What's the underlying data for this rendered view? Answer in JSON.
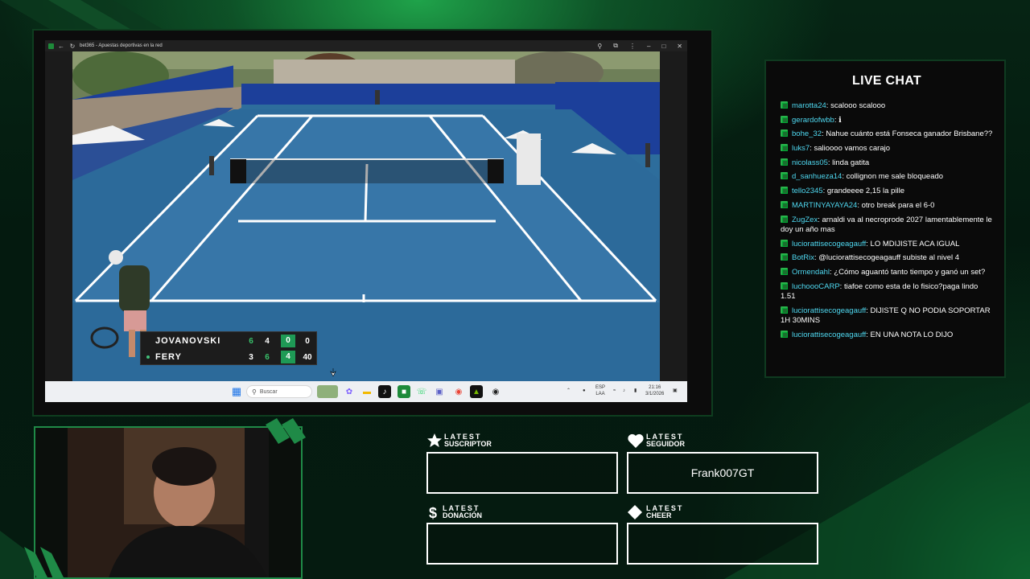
{
  "browser": {
    "tab_title": "bet365 - Apuestas deportivas en la red",
    "nav_icons": [
      "back-icon",
      "reload-icon"
    ],
    "window_icons": [
      "zoom-icon",
      "extension-icon",
      "more-icon",
      "minimize-icon",
      "maximize-icon",
      "close-icon"
    ]
  },
  "scoreboard": {
    "players": [
      {
        "name": "JOVANOVSKI",
        "set1": "6",
        "set2": "4",
        "set3": "0",
        "game": "0",
        "serving": false
      },
      {
        "name": "FERY",
        "set1": "3",
        "set2": "6",
        "set3": "4",
        "game": "40",
        "serving": true
      }
    ]
  },
  "taskbar": {
    "search_placeholder": "Buscar",
    "lang_top": "ESP",
    "lang_bottom": "LAA",
    "time": "21:16",
    "date": "3/1/2026"
  },
  "chat": {
    "title": "LIVE CHAT",
    "messages": [
      {
        "user": "marotta24",
        "text": "scalooo scalooo"
      },
      {
        "user": "gerardofwbb",
        "text": "ℹ"
      },
      {
        "user": "bohe_32",
        "text": "Nahue cuánto está Fonseca ganador Brisbane??"
      },
      {
        "user": "luks7",
        "text": "salioooo vamos carajo"
      },
      {
        "user": "nicolass05",
        "text": "linda gatita"
      },
      {
        "user": "d_sanhueza14",
        "text": "collignon me sale bloqueado"
      },
      {
        "user": "tello2345",
        "text": "grandeeee 2,15 la pille"
      },
      {
        "user": "MARTINYAYAYA24",
        "text": "otro break para el 6-0"
      },
      {
        "user": "ZugZex",
        "text": "arnaldi va al necroprode 2027 lamentablemente le doy un año mas"
      },
      {
        "user": "luciorattisecogeagauff",
        "text": "LO MDIJISTE ACA IGUAL"
      },
      {
        "user": "BotRix",
        "text": "@luciorattisecogeagauff subiste al nivel 4"
      },
      {
        "user": "Ormendahl",
        "text": "¿Cómo aguantó tanto tiempo y ganó un set?"
      },
      {
        "user": "luchoooCARP",
        "text": "tiafoe como esta de lo fisico?paga lindo 1.51"
      },
      {
        "user": "luciorattisecogeagauff",
        "text": "DIJISTE Q NO PODIA SOPORTAR 1H 30MINS"
      },
      {
        "user": "luciorattisecogeagauff",
        "text": "EN UNA NOTA LO DIJO"
      }
    ]
  },
  "stats": {
    "subscriber": {
      "label_top": "LATEST",
      "label_bottom": "SUSCRIPTOR",
      "value": ""
    },
    "follower": {
      "label_top": "LATEST",
      "label_bottom": "SEGUIDOR",
      "value": "Frank007GT"
    },
    "donation": {
      "label_top": "LATEST",
      "label_bottom": "DONACIÓN",
      "value": ""
    },
    "cheer": {
      "label_top": "LATEST",
      "label_bottom": "CHEER",
      "value": ""
    }
  },
  "colors": {
    "accent_green": "#1f8a47",
    "chat_username": "#4fd8f0",
    "score_highlight": "#1e9a55"
  }
}
